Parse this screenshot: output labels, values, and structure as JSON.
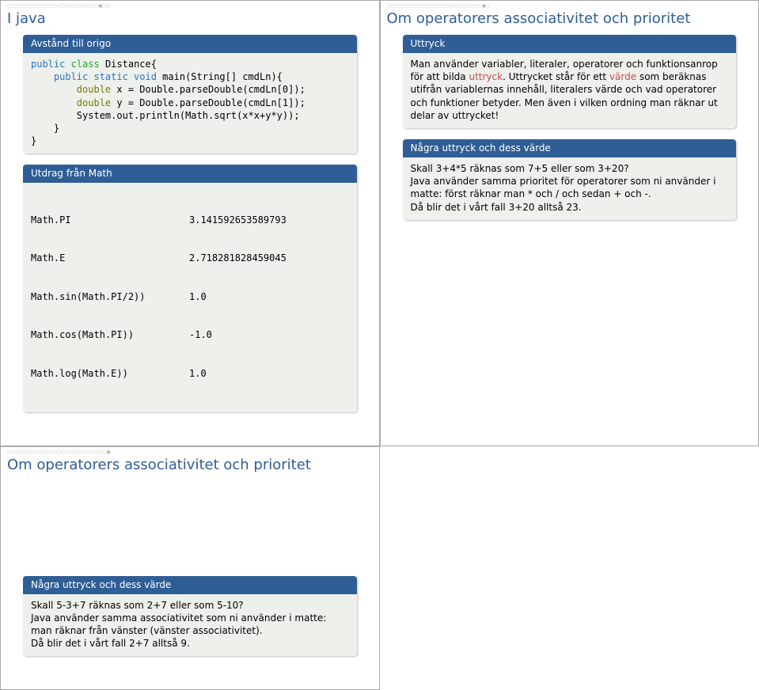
{
  "slide1": {
    "nav": "○○○○○○○○○○○○○○○○○○○○○○●○○",
    "title": "I java",
    "block1_header": "Avstånd till origo",
    "code_l1a": "public",
    "code_l1b": " class",
    "code_l1c": " Distance{",
    "code_l2a": "    public static void",
    "code_l2b": " main(String[] cmdLn){",
    "code_l3a": "        double",
    "code_l3b": " x = Double.parseDouble(cmdLn[0]);",
    "code_l4a": "        double",
    "code_l4b": " y = Double.parseDouble(cmdLn[1]);",
    "code_l5": "        System.out.println(Math.sqrt(x*x+y*y));",
    "code_l6": "    }",
    "code_l7": "}",
    "block2_header": "Utdrag från Math",
    "math_r1a": "Math.PI",
    "math_r1b": "3.141592653589793",
    "math_r2a": "Math.E",
    "math_r2b": "2.718281828459045",
    "math_r3a": "Math.sin(Math.PI/2))",
    "math_r3b": "1.0",
    "math_r4a": "Math.cos(Math.PI))",
    "math_r4b": "-1.0",
    "math_r5a": "Math.log(Math.E))",
    "math_r5b": "1.0"
  },
  "slide2": {
    "nav": "○○○○○○○○○○○○○○○○○○○○○○○●○",
    "title": "Om operatorers associativitet och prioritet",
    "b1_header": "Uttryck",
    "b1_t1": "Man använder variabler, literaler, operatorer och funktionsanrop för att bilda ",
    "b1_term1": "uttryck",
    "b1_t2": ". Uttrycket står för ett ",
    "b1_term2": "värde",
    "b1_t3": " som beräknas utifrån variablernas innehåll, literalers värde och vad operatorer och funktioner betyder. Men även i vilken ordning man räknar ut delar av uttrycket!",
    "b2_header": "Några uttryck och dess värde",
    "b2_l1": "Skall 3+4*5 räknas som 7+5 eller som 3+20?",
    "b2_l2": "Java använder samma prioritet för operatorer som ni använder i matte: först räknar man * och / och sedan + och -.",
    "b2_l3": "Då blir det i vårt fall 3+20 alltså 23."
  },
  "slide3": {
    "nav": "○○○○○○○○○○○○○○○○○○○○○○○○●",
    "title": "Om operatorers associativitet och prioritet",
    "b_header": "Några uttryck och dess värde",
    "b_l1": "Skall 5-3+7 räknas som 2+7 eller som 5-10?",
    "b_l2": "Java använder samma associativitet som ni använder i matte: man räknar från vänster (vänster associativitet).",
    "b_l3": "Då blir det i vårt fall 2+7 alltså 9."
  }
}
